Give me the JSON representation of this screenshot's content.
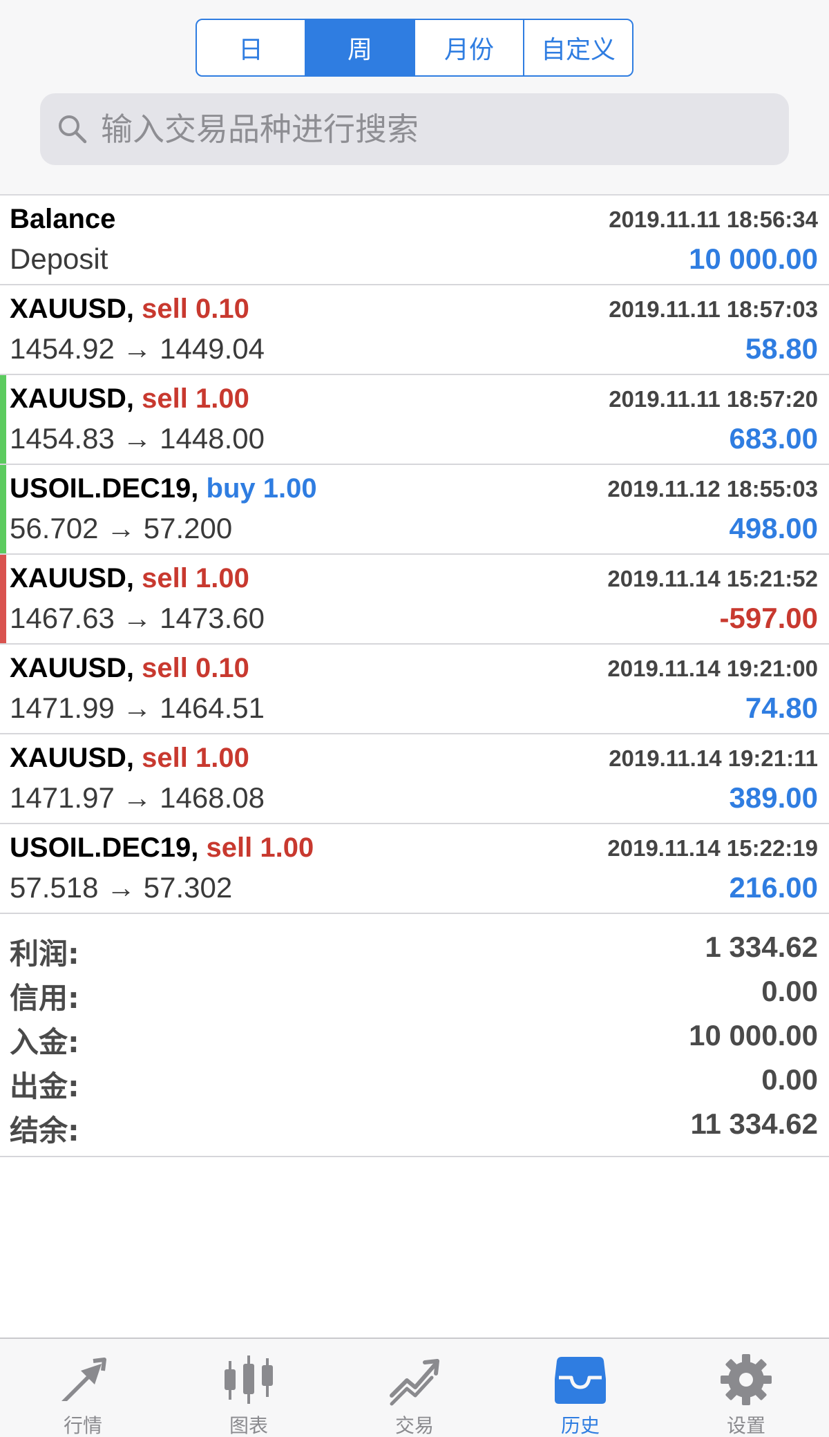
{
  "period_tabs": [
    {
      "label": "日",
      "active": false
    },
    {
      "label": "周",
      "active": true
    },
    {
      "label": "月份",
      "active": false
    },
    {
      "label": "自定义",
      "active": false
    }
  ],
  "search": {
    "placeholder": "输入交易品种进行搜索"
  },
  "balance_entry": {
    "title": "Balance",
    "time": "2019.11.11 18:56:34",
    "comment": "Deposit",
    "amount": "10 000.00"
  },
  "deals": [
    {
      "symbol": "XAUUSD,",
      "action": "sell 0.10",
      "direction": "sell",
      "time": "2019.11.11 18:57:03",
      "prices": "1454.92 → 1449.04",
      "profit": "58.80",
      "profit_sign": "pos",
      "marker": "none"
    },
    {
      "symbol": "XAUUSD,",
      "action": "sell 1.00",
      "direction": "sell",
      "time": "2019.11.11 18:57:20",
      "prices": "1454.83 → 1448.00",
      "profit": "683.00",
      "profit_sign": "pos",
      "marker": "green"
    },
    {
      "symbol": "USOIL.DEC19,",
      "action": "buy 1.00",
      "direction": "buy",
      "time": "2019.11.12 18:55:03",
      "prices": "56.702 → 57.200",
      "profit": "498.00",
      "profit_sign": "pos",
      "marker": "green"
    },
    {
      "symbol": "XAUUSD,",
      "action": "sell 1.00",
      "direction": "sell",
      "time": "2019.11.14 15:21:52",
      "prices": "1467.63 → 1473.60",
      "profit": "-597.00",
      "profit_sign": "neg",
      "marker": "red"
    },
    {
      "symbol": "XAUUSD,",
      "action": "sell 0.10",
      "direction": "sell",
      "time": "2019.11.14 19:21:00",
      "prices": "1471.99 → 1464.51",
      "profit": "74.80",
      "profit_sign": "pos",
      "marker": "none"
    },
    {
      "symbol": "XAUUSD,",
      "action": "sell 1.00",
      "direction": "sell",
      "time": "2019.11.14 19:21:11",
      "prices": "1471.97 → 1468.08",
      "profit": "389.00",
      "profit_sign": "pos",
      "marker": "none"
    },
    {
      "symbol": "USOIL.DEC19,",
      "action": "sell 1.00",
      "direction": "sell",
      "time": "2019.11.14 15:22:19",
      "prices": "57.518 → 57.302",
      "profit": "216.00",
      "profit_sign": "pos",
      "marker": "none"
    }
  ],
  "summary": [
    {
      "label": "利润:",
      "value": "1 334.62"
    },
    {
      "label": "信用:",
      "value": "0.00"
    },
    {
      "label": "入金:",
      "value": "10 000.00"
    },
    {
      "label": "出金:",
      "value": "0.00"
    },
    {
      "label": "结余:",
      "value": "11 334.62"
    }
  ],
  "tabbar": [
    {
      "label": "行情",
      "icon": "quotes-icon",
      "active": false
    },
    {
      "label": "图表",
      "icon": "chart-icon",
      "active": false
    },
    {
      "label": "交易",
      "icon": "trade-icon",
      "active": false
    },
    {
      "label": "历史",
      "icon": "history-icon",
      "active": true
    },
    {
      "label": "设置",
      "icon": "settings-icon",
      "active": false
    }
  ],
  "colors": {
    "accent": "#2f7de1",
    "sell": "#c8392f",
    "loss": "#c8392f",
    "profit_marker": "#5ccb5f",
    "loss_marker": "#d9534f",
    "inactive_icon": "#8a8a8e"
  }
}
